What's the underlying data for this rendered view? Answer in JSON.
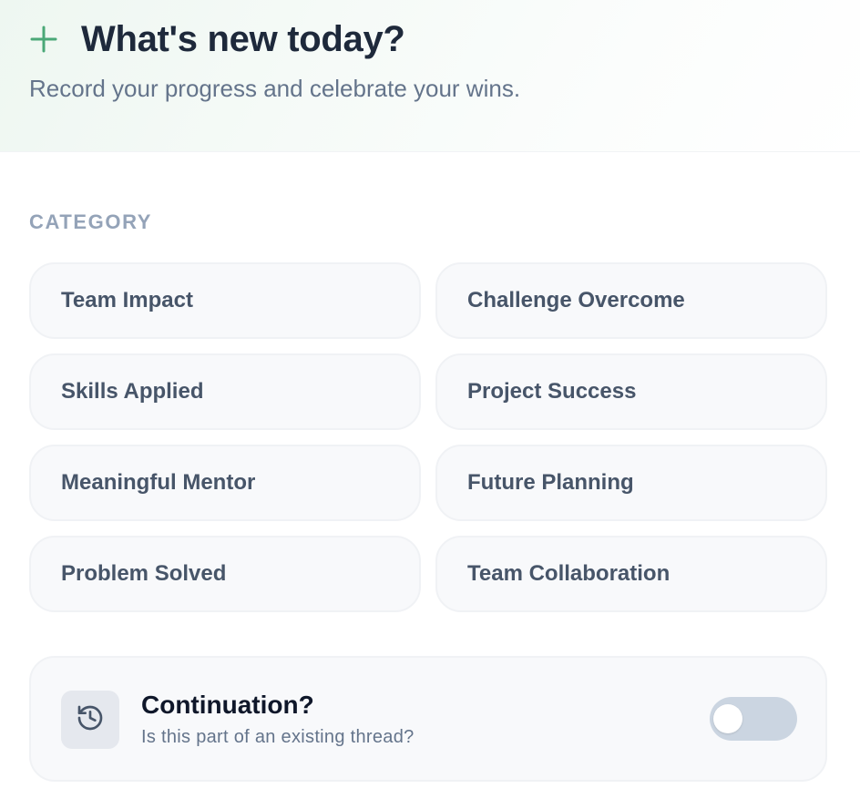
{
  "header": {
    "title": "What's new today?",
    "subtitle": "Record your progress and celebrate your wins.",
    "icon": "plus-icon",
    "accent_color": "#4aa877"
  },
  "category": {
    "label": "CATEGORY",
    "options": [
      {
        "label": "Team Impact"
      },
      {
        "label": "Challenge Overcome"
      },
      {
        "label": "Skills Applied"
      },
      {
        "label": "Project Success"
      },
      {
        "label": "Meaningful Mentor"
      },
      {
        "label": "Future Planning"
      },
      {
        "label": "Problem Solved"
      },
      {
        "label": "Team Collaboration"
      }
    ]
  },
  "continuation": {
    "title": "Continuation?",
    "subtitle": "Is this part of an existing thread?",
    "icon": "history-icon",
    "toggle_on": false
  }
}
